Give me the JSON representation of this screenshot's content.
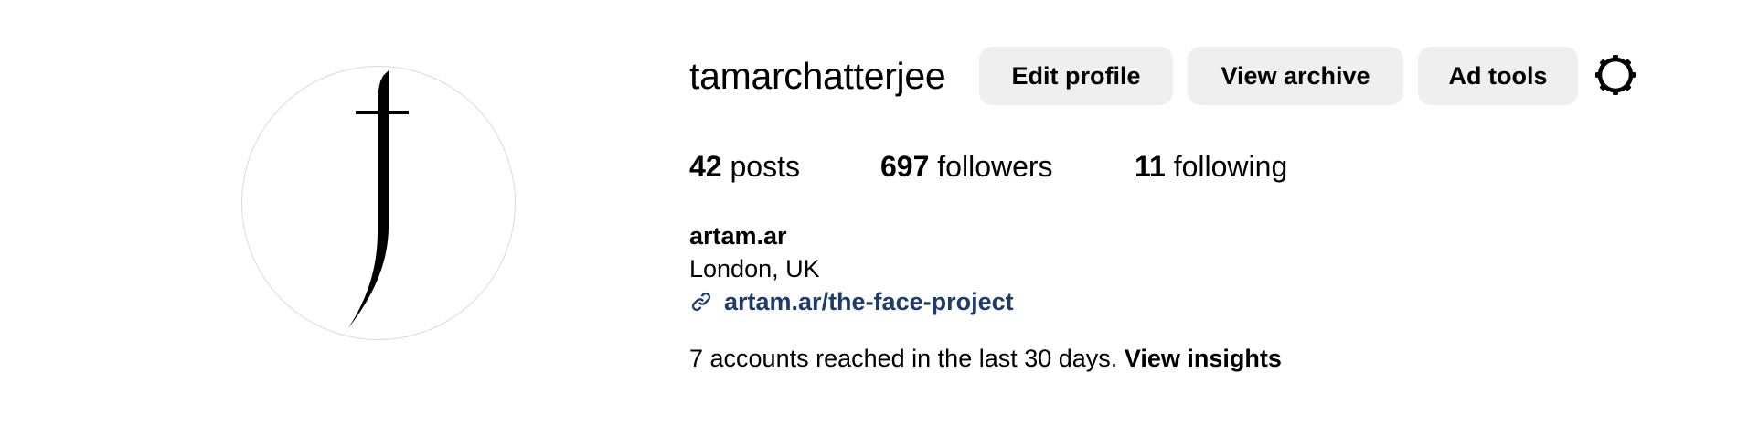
{
  "profile": {
    "username": "tamarchatterjee",
    "avatar_icon": "dagger-j-logo"
  },
  "actions": {
    "edit_profile": "Edit profile",
    "view_archive": "View archive",
    "ad_tools": "Ad tools",
    "settings_icon": "gear-icon"
  },
  "stats": {
    "posts_count": "42",
    "posts_label": "posts",
    "followers_count": "697",
    "followers_label": "followers",
    "following_count": "11",
    "following_label": "following"
  },
  "bio": {
    "name": "artam.ar",
    "location": "London, UK",
    "link_icon": "link-icon",
    "link_text": "artam.ar/the-face-project",
    "link_color": "#1d3c6d"
  },
  "insights": {
    "text": "7 accounts reached in the last 30 days.",
    "link_label": "View insights"
  },
  "colors": {
    "button_bg": "#efefef",
    "avatar_border": "#dbdbdb",
    "text": "#000000"
  }
}
